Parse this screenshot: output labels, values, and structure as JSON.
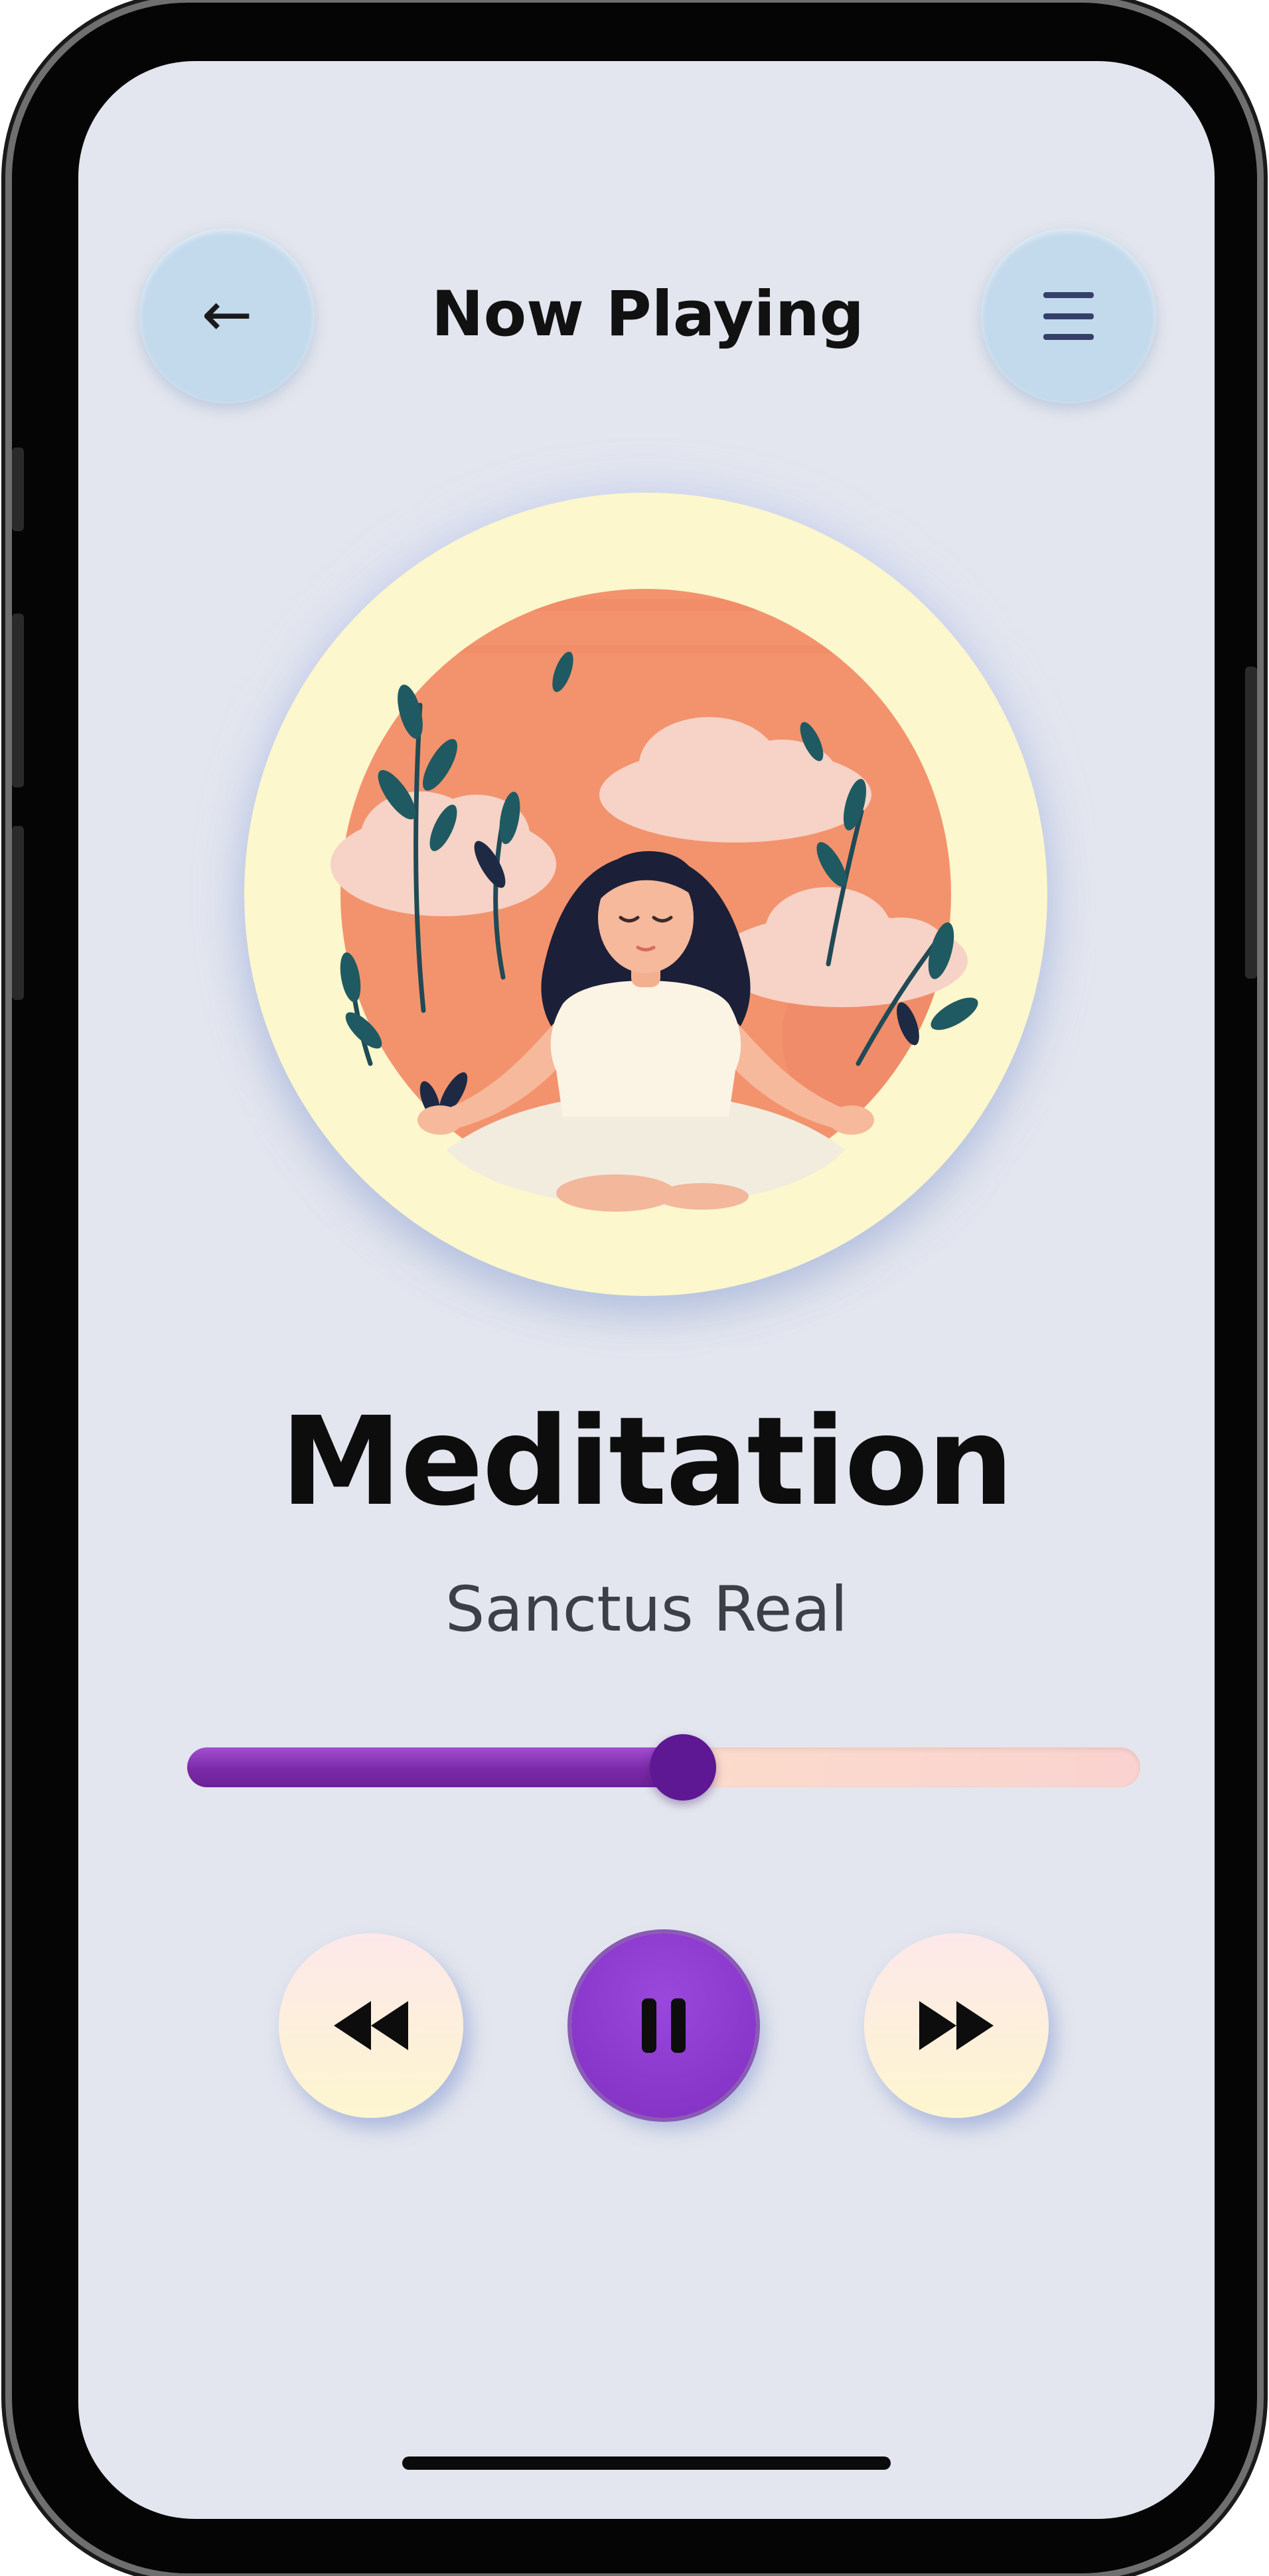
{
  "header": {
    "title": "Now Playing",
    "back_icon": "arrow-left-icon",
    "menu_icon": "hamburger-menu-icon"
  },
  "album": {
    "artwork": "meditating-woman-illustration"
  },
  "track": {
    "title": "Meditation",
    "artist": "Sanctus Real"
  },
  "playback": {
    "progress_fraction": 0.52,
    "state": "playing"
  },
  "controls": {
    "rewind_icon": "rewind-icon",
    "pause_icon": "pause-icon",
    "forward_icon": "fast-forward-icon"
  },
  "colors": {
    "screen_background": "#e3e6ee",
    "header_button": "#c3d9ec",
    "accent_purple": "#8836c9",
    "slider_thumb": "#5e1893",
    "album_ring": "#fcf7cc",
    "album_sun": "#f3936e"
  }
}
